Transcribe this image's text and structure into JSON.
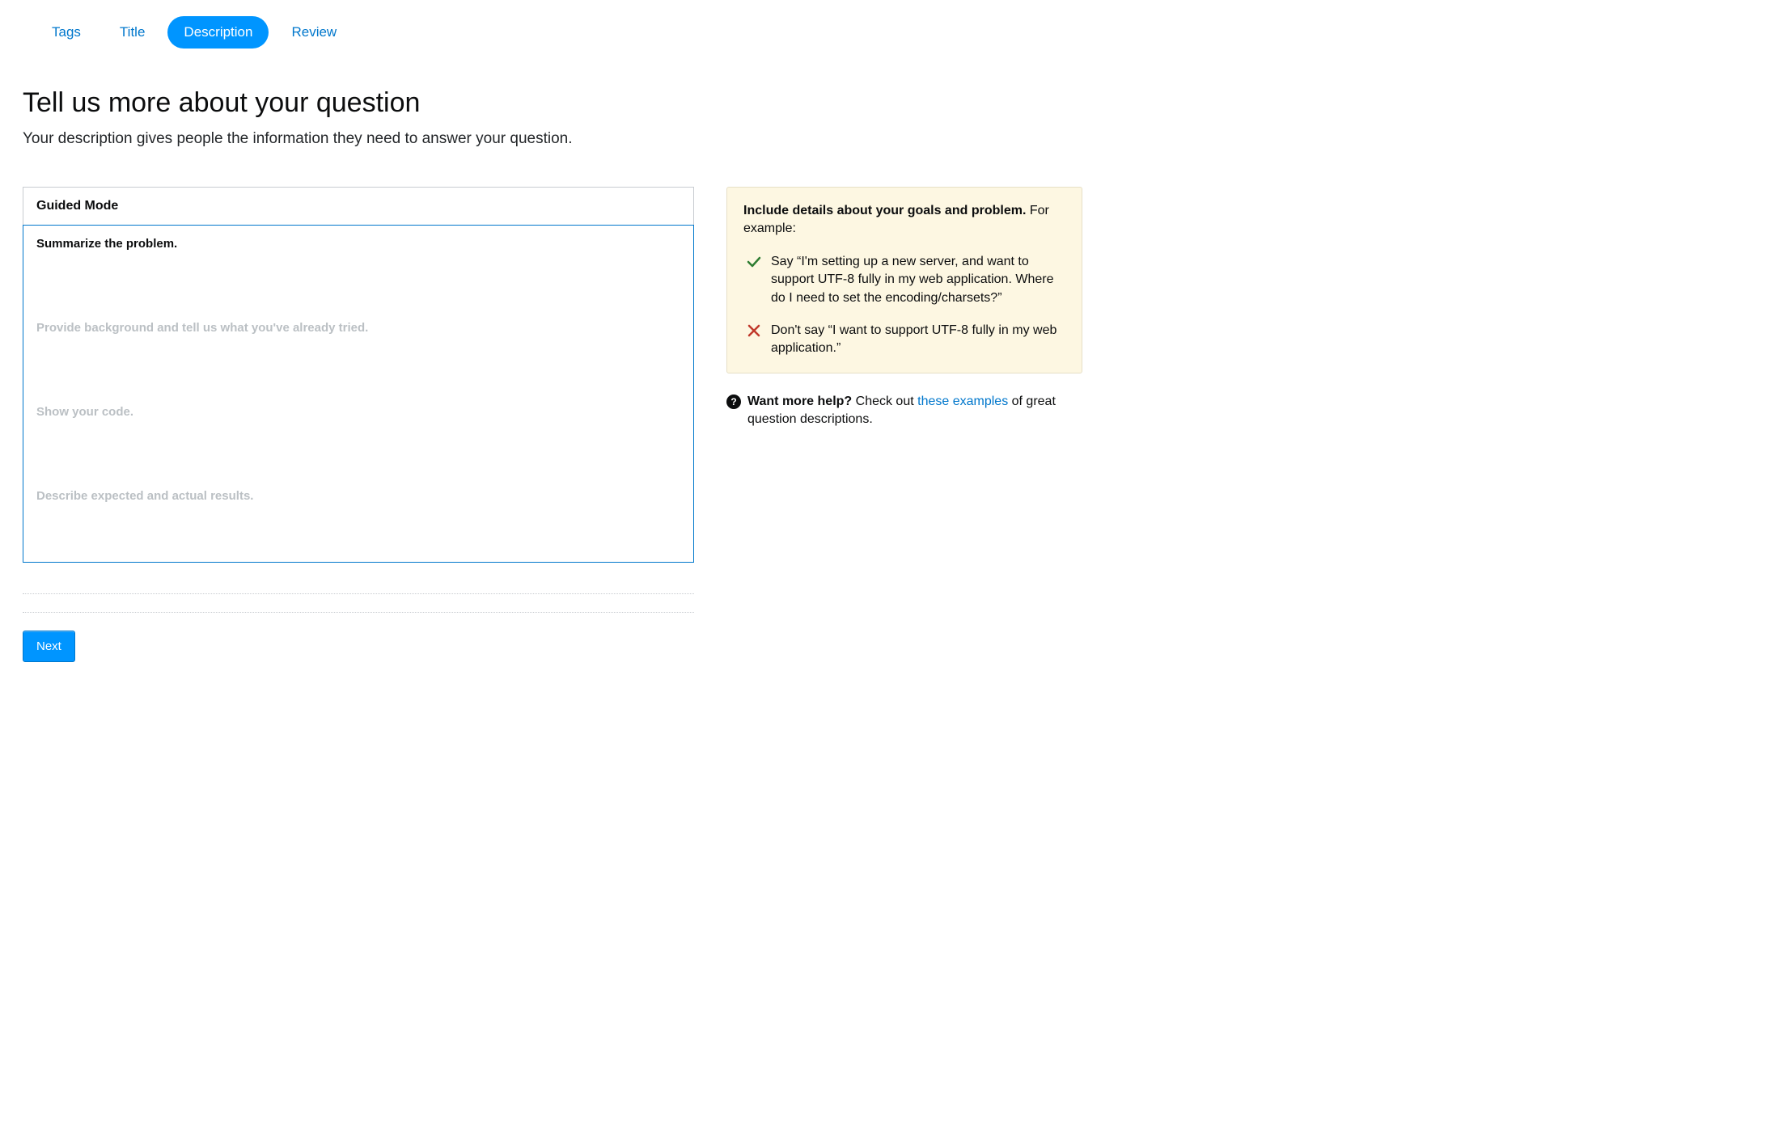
{
  "tabs": {
    "tags": "Tags",
    "title": "Title",
    "description": "Description",
    "review": "Review"
  },
  "page": {
    "title": "Tell us more about your question",
    "subtitle": "Your description gives people the information they need to answer your question."
  },
  "guided": {
    "header": "Guided Mode",
    "prompts": {
      "summarize": "Summarize the problem.",
      "background": "Provide background and tell us what you've already tried.",
      "code": "Show your code.",
      "results": "Describe expected and actual results."
    }
  },
  "next_button": "Next",
  "tips": {
    "intro_bold": "Include details about your goals and problem.",
    "intro_tail": " For example:",
    "do_text": "Say “I'm setting up a new server, and want to support UTF-8 fully in my web application. Where do I need to set the encoding/charsets?”",
    "dont_text": "Don't say “I want to support UTF-8 fully in my web application.”"
  },
  "help": {
    "bold": "Want more help?",
    "before_link": " Check out ",
    "link": "these examples",
    "after_link": " of great question descriptions."
  }
}
